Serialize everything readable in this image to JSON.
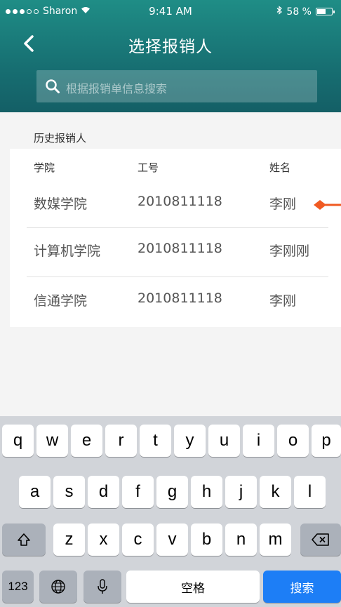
{
  "status_bar": {
    "carrier": "Sharon",
    "time": "9:41 AM",
    "battery_text": "58 %",
    "battery_level": 0.58
  },
  "header": {
    "title": "选择报销人",
    "back_icon": "chevron-left-icon"
  },
  "search": {
    "placeholder": "根据报销单信息搜索",
    "icon": "search-icon"
  },
  "history": {
    "label": "历史报销人",
    "columns": [
      "学院",
      "工号",
      "姓名"
    ],
    "rows": [
      {
        "college": "数媒学院",
        "id": "2010811118",
        "name": "李刚"
      },
      {
        "college": "计算机学院",
        "id": "2010811118",
        "name": "李刚刚"
      },
      {
        "college": "信通学院",
        "id": "2010811118",
        "name": "李刚"
      }
    ]
  },
  "keyboard": {
    "row1": [
      "q",
      "w",
      "e",
      "r",
      "t",
      "y",
      "u",
      "i",
      "o",
      "p"
    ],
    "row2": [
      "a",
      "s",
      "d",
      "f",
      "g",
      "h",
      "j",
      "k",
      "l"
    ],
    "row3": [
      "z",
      "x",
      "c",
      "v",
      "b",
      "n",
      "m"
    ],
    "numbers_key": "123",
    "space_key": "空格",
    "search_key": "搜索"
  },
  "colors": {
    "header": "#176f72",
    "pointer": "#f05a22",
    "search_key": "#1d7ef6"
  }
}
